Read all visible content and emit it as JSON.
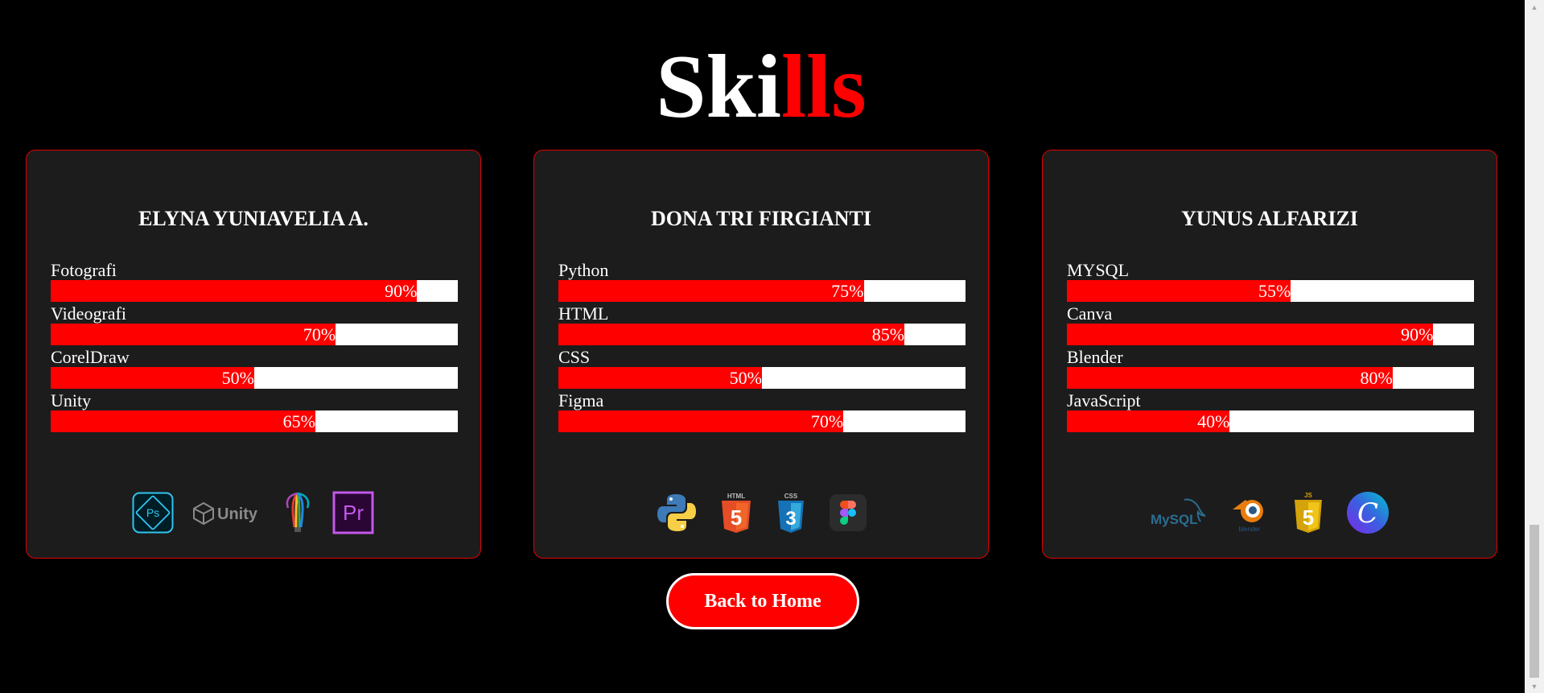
{
  "title": {
    "part1": "Ski",
    "part2": "lls"
  },
  "cards": [
    {
      "name": "ELYNA YUNIAVELIA A.",
      "skills": [
        {
          "label": "Fotografi",
          "percent": 90,
          "percent_text": "90%"
        },
        {
          "label": "Videografi",
          "percent": 70,
          "percent_text": "70%"
        },
        {
          "label": "CorelDraw",
          "percent": 50,
          "percent_text": "50%"
        },
        {
          "label": "Unity",
          "percent": 65,
          "percent_text": "65%"
        }
      ],
      "icons": [
        "photoshop-express-icon",
        "unity-logo-icon",
        "coreldraw-icon",
        "premiere-pro-icon"
      ],
      "icon_text": {
        "ps": "Ps",
        "unity": "Unity",
        "pr": "Pr"
      }
    },
    {
      "name": "DONA TRI FIRGIANTI",
      "skills": [
        {
          "label": "Python",
          "percent": 75,
          "percent_text": "75%"
        },
        {
          "label": "HTML",
          "percent": 85,
          "percent_text": "85%"
        },
        {
          "label": "CSS",
          "percent": 50,
          "percent_text": "50%"
        },
        {
          "label": "Figma",
          "percent": 70,
          "percent_text": "70%"
        }
      ],
      "icons": [
        "python-icon",
        "html5-icon",
        "css3-icon",
        "figma-icon"
      ],
      "icon_text": {
        "html": "HTML",
        "css": "CSS",
        "html_num": "5",
        "css_num": "3"
      }
    },
    {
      "name": "YUNUS ALFARIZI",
      "skills": [
        {
          "label": "MYSQL",
          "percent": 55,
          "percent_text": "55%"
        },
        {
          "label": "Canva",
          "percent": 90,
          "percent_text": "90%"
        },
        {
          "label": "Blender",
          "percent": 80,
          "percent_text": "80%"
        },
        {
          "label": "JavaScript",
          "percent": 40,
          "percent_text": "40%"
        }
      ],
      "icons": [
        "mysql-icon",
        "blender-icon",
        "javascript-icon",
        "canva-icon"
      ],
      "icon_text": {
        "mysql": "MySQL",
        "blender": "blender",
        "js": "JS",
        "js_num": "5",
        "canva": "C"
      }
    }
  ],
  "back_button": {
    "label": "Back to Home"
  },
  "colors": {
    "accent": "#ff0000",
    "card_bg": "#1c1c1c",
    "page_bg": "#000000"
  }
}
